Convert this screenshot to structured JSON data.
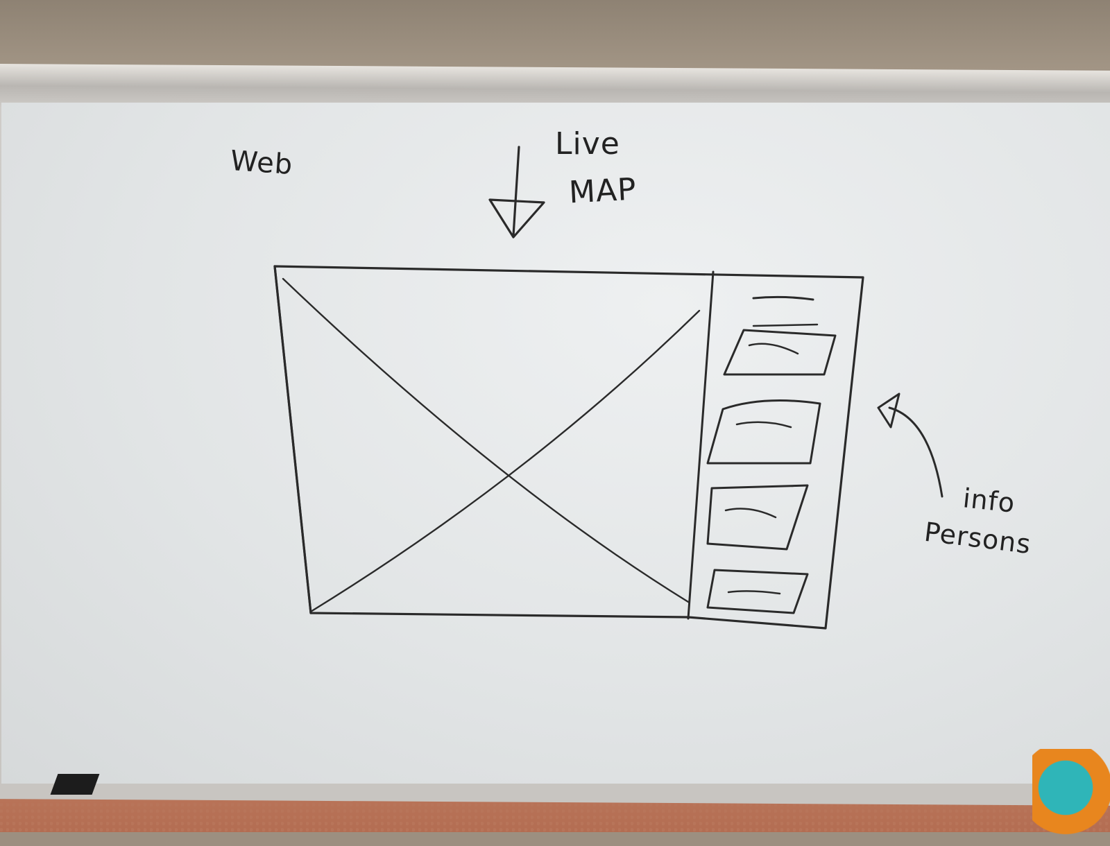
{
  "whiteboard": {
    "label_web": "Web",
    "label_live": "Live",
    "label_map": "MAP",
    "label_info": "info",
    "label_persons": "Persons",
    "ink_color": "#2a2a2a"
  },
  "sketch": {
    "map_placeholder": "crossed-box",
    "sidebar_cards": 4
  }
}
